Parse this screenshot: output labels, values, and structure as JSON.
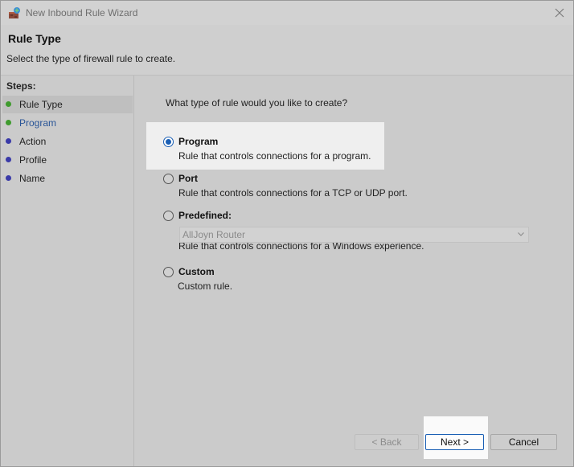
{
  "window": {
    "title": "New Inbound Rule Wizard"
  },
  "header": {
    "title": "Rule Type",
    "subtitle": "Select the type of firewall rule to create."
  },
  "steps": {
    "label": "Steps:",
    "items": [
      {
        "label": "Rule Type",
        "status": "complete",
        "dot_color": "#3f9b2e"
      },
      {
        "label": "Program",
        "status": "complete",
        "dot_color": "#3f9b2e"
      },
      {
        "label": "Action",
        "status": "pending",
        "dot_color": "#3a3aa8"
      },
      {
        "label": "Profile",
        "status": "pending",
        "dot_color": "#3a3aa8"
      },
      {
        "label": "Name",
        "status": "pending",
        "dot_color": "#3a3aa8"
      }
    ]
  },
  "main": {
    "question": "What type of rule would you like to create?",
    "options": [
      {
        "title": "Program",
        "desc": "Rule that controls connections for a program.",
        "checked": true
      },
      {
        "title": "Port",
        "desc": "Rule that controls connections for a TCP or UDP port.",
        "checked": false
      },
      {
        "title": "Predefined:",
        "desc": "Rule that controls connections for a Windows experience.",
        "checked": false
      },
      {
        "title": "Custom",
        "desc": "Custom rule.",
        "checked": false
      }
    ],
    "predefined_dropdown": {
      "value": "AllJoyn Router"
    }
  },
  "buttons": {
    "back": "< Back",
    "next": "Next >",
    "cancel": "Cancel"
  },
  "colors": {
    "accent": "#1a5fb4",
    "link": "#2a5597"
  }
}
